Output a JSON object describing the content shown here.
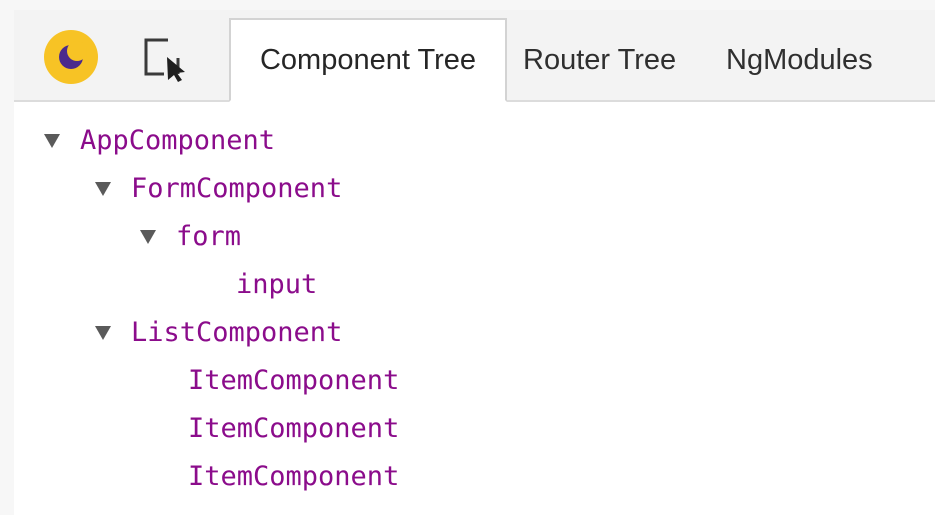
{
  "toolbar": {
    "theme_icon": "moon-icon",
    "select_icon": "cursor-select-icon",
    "tabs": [
      {
        "label": "Component Tree",
        "active": true
      },
      {
        "label": "Router Tree",
        "active": false
      },
      {
        "label": "NgModules",
        "active": false
      }
    ]
  },
  "tree": {
    "nodes": [
      {
        "label": "AppComponent",
        "expanded": true
      },
      {
        "label": "FormComponent",
        "expanded": true
      },
      {
        "label": "form",
        "expanded": true
      },
      {
        "label": "input"
      },
      {
        "label": "ListComponent",
        "expanded": true
      },
      {
        "label": "ItemComponent"
      },
      {
        "label": "ItemComponent"
      },
      {
        "label": "ItemComponent"
      }
    ]
  },
  "colors": {
    "node_text": "#8b0c8b",
    "theme_yellow": "#f7c325",
    "theme_moon": "#4b2a8c",
    "toolbar_bg": "#f3f3f3"
  }
}
